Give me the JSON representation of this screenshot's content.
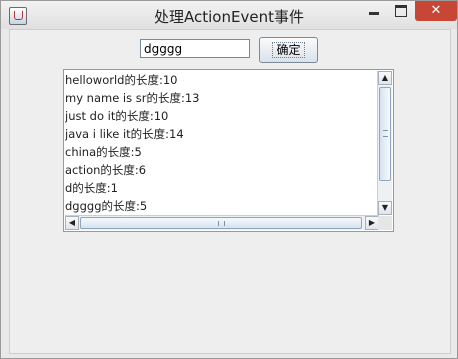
{
  "window": {
    "title": "处理ActionEvent事件",
    "app_icon": "java-cup-icon",
    "controls": {
      "minimize_icon": "minimize-icon",
      "maximize_icon": "maximize-icon",
      "close_glyph": "✕"
    }
  },
  "form": {
    "input_value": "dgggg",
    "confirm_label": "确定"
  },
  "output": {
    "lines": [
      "helloworld的长度:10",
      "my name is sr的长度:13",
      "just do it的长度:10",
      "java i like it的长度:14",
      "china的长度:5",
      "action的长度:6",
      "d的长度:1",
      "dgggg的长度:5"
    ]
  },
  "scrollbars": {
    "up_arrow": "▲",
    "down_arrow": "▼",
    "left_arrow": "◀",
    "right_arrow": "▶"
  }
}
